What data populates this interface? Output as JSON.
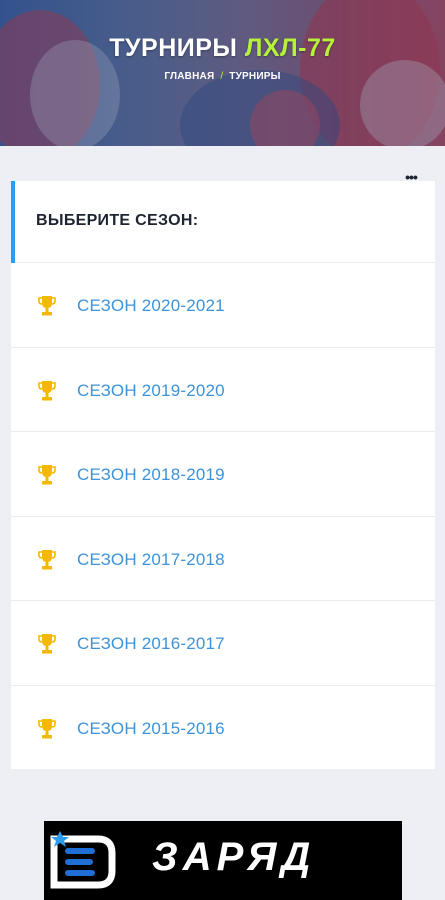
{
  "hero": {
    "title_main": "ТУРНИРЫ",
    "title_accent": "ЛХЛ-77",
    "breadcrumb": {
      "home": "ГЛАВНАЯ",
      "separator": "/",
      "current": "ТУРНИРЫ"
    }
  },
  "menu": {
    "icon": "more-dots-icon",
    "glyph": "•••"
  },
  "seasons_card": {
    "heading": "ВЫБЕРИТЕ СЕЗОН:",
    "items": [
      {
        "label": "СЕЗОН 2020-2021",
        "icon": "trophy-icon"
      },
      {
        "label": "СЕЗОН 2019-2020",
        "icon": "trophy-icon"
      },
      {
        "label": "СЕЗОН 2018-2019",
        "icon": "trophy-icon"
      },
      {
        "label": "СЕЗОН 2017-2018",
        "icon": "trophy-icon"
      },
      {
        "label": "СЕЗОН 2016-2017",
        "icon": "trophy-icon"
      },
      {
        "label": "СЕЗОН 2015-2016",
        "icon": "trophy-icon"
      }
    ]
  },
  "banner": {
    "brand": "ЗАРЯД",
    "logo": "zaryad-logo"
  },
  "colors": {
    "accent_green": "#b7f23a",
    "link_blue": "#3d93d8",
    "active_bar": "#2d9bf0",
    "trophy_gold": "#f5b800",
    "page_bg": "#edeff4"
  }
}
